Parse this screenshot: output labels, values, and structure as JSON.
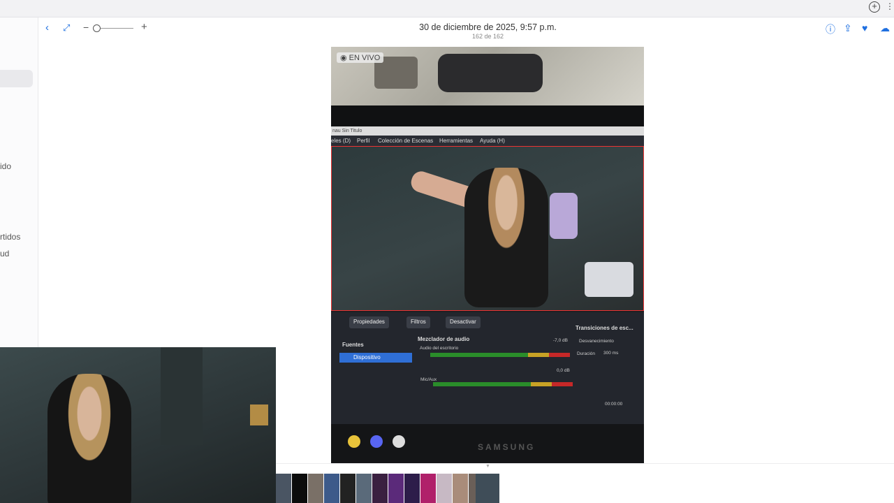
{
  "sidebar": {
    "items": [
      {
        "label": "ido"
      },
      {
        "label": "rtidos"
      },
      {
        "label": "ud"
      }
    ]
  },
  "header": {
    "title": "30 de diciembre de 2025, 9:57 p.m.",
    "counter": "162 de 162",
    "icons": [
      "back-icon",
      "fullscreen-icon",
      "zoom-out-icon",
      "zoom-slider",
      "zoom-in-icon",
      "info-icon",
      "share-icon",
      "favorite-icon",
      "cloud-download-icon"
    ],
    "favorite_color": "#1e6fe0"
  },
  "photo": {
    "live_badge": "EN VIVO",
    "obs": {
      "window_title": "nau Sin Titulo",
      "menu": [
        "eles (D)",
        "Perfil",
        "Colección de Escenas",
        "Herramientas",
        "Ayuda (H)"
      ],
      "buttons": [
        "Propiedades",
        "Filtros",
        "Desactivar"
      ],
      "sources_label": "Fuentes",
      "source_item": "Dispositivo",
      "mixer_label": "Mezclador de audio",
      "desktop_audio": "Audio del escritorio",
      "desktop_db": "-7,0 dB",
      "mic_label": "Mic/Aux",
      "mic_db": "0,0 dB",
      "transitions_label": "Transiciones de esc...",
      "transition_value": "Desvanecimiento",
      "duration_label": "Duración",
      "duration_value": "300 ms",
      "timecode": "00:00:00"
    },
    "brand": "SAMSUNG"
  },
  "filmstrip": {
    "thumb_colors": [
      "#4a5563",
      "#0c0c0c",
      "#7a7067",
      "#3d5a8a",
      "#222",
      "#5a6a7a",
      "#3a2040",
      "#5b2a7a",
      "#2d1d4a",
      "#b0206a",
      "#c7b9c4",
      "#a98c7a",
      "#6a5f58",
      "#3f4d58"
    ]
  }
}
